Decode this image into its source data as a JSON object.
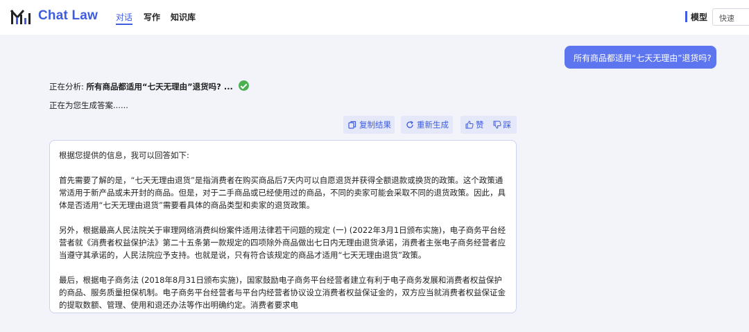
{
  "header": {
    "app_name": "Chat Law",
    "nav": [
      {
        "label": "对话",
        "active": true
      },
      {
        "label": "写作",
        "active": false
      },
      {
        "label": "知识库",
        "active": false
      }
    ],
    "model_label": "模型",
    "model_value": "快速"
  },
  "colors": {
    "brand": "#3d5ce0",
    "user_bubble": "#5d76ef",
    "success": "#4cb050",
    "background": "#f2f4fa"
  },
  "chat": {
    "user_message": "所有商品都适用“七天无理由”退货吗?",
    "analysis_prefix": "正在分析:",
    "analysis_query": "所有商品都适用“七天无理由”退货吗? ...",
    "status_icon": "check-circle-icon",
    "generating_text": "正在为您生成答案......",
    "actions": {
      "copy": "复制结果",
      "regenerate": "重新生成",
      "like": "赞",
      "dislike": "踩"
    },
    "answer_paragraphs": [
      "根据您提供的信息，我可以回答如下:",
      "首先需要了解的是，“七天无理由退货”是指消费者在购买商品后7天内可以自愿退货并获得全额退款或换货的政策。这个政策通常适用于新产品或未开封的商品。但是，对于二手商品或已经使用过的商品，不同的卖家可能会采取不同的退货政策。因此，具体是否适用“七天无理由退货”需要看具体的商品类型和卖家的退货政策。",
      "另外，根据最高人民法院关于审理网络消费纠纷案件适用法律若干问题的规定 (一) (2022年3月1日颁布实施)，电子商务平台经营者就《消费者权益保护法》第二十五条第一款规定的四项除外商品做出七日内无理由退货承诺，消费者主张电子商务经营者应当遵守其承诺的，人民法院应予支持。也就是说，只有符合该规定的商品才适用“七天无理由退货”政策。",
      "最后，根据电子商务法 (2018年8月31日颁布实施)，国家鼓励电子商务平台经营者建立有利于电子商务发展和消费者权益保护的商品、服务质量担保机制。电子商务平台经营者与平台内经营者协议设立消费者权益保证金的，双方应当就消费者权益保证金的提取数额、管理、使用和退还办法等作出明确约定。消费者要求电"
    ]
  }
}
